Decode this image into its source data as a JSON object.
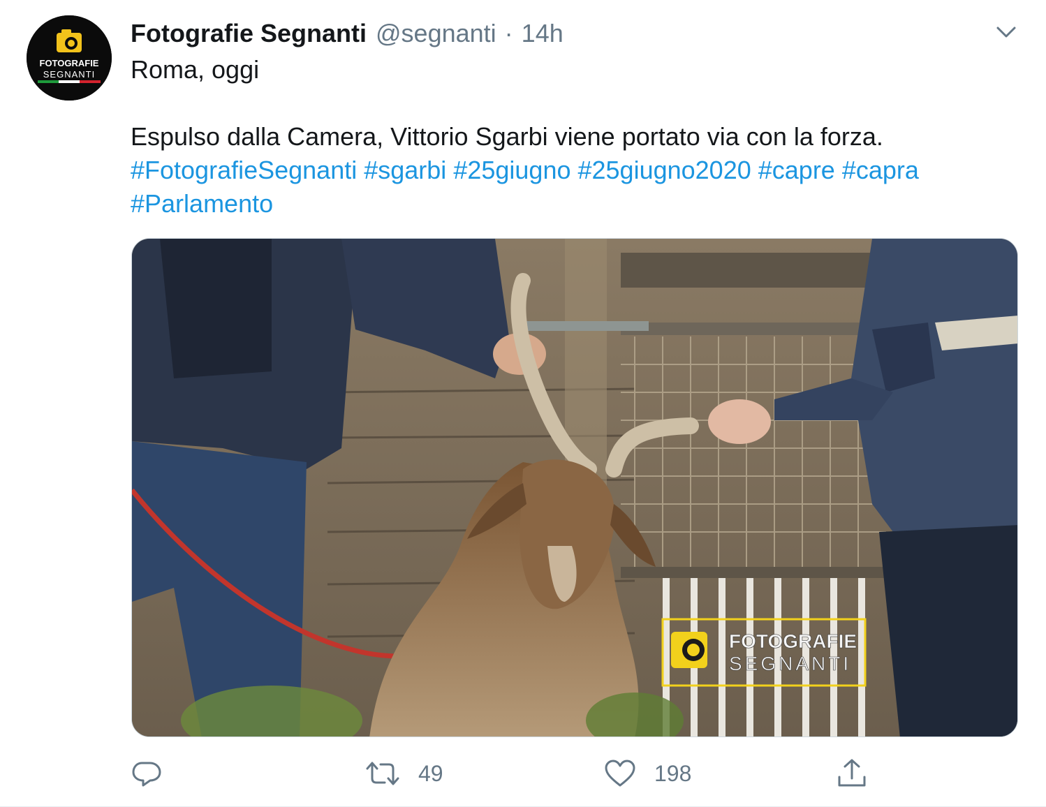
{
  "tweet": {
    "author": {
      "display_name": "Fotografie Segnanti",
      "handle": "@segnanti",
      "separator": "·",
      "time": "14h",
      "avatar_text_line1": "FOTOGRAFIE",
      "avatar_text_line2": "SEGNANTI"
    },
    "text": {
      "line1": "Roma, oggi",
      "line2": "Espulso dalla Camera, Vittorio Sgarbi viene portato via con la forza."
    },
    "hashtags": [
      "#FotografieSegnanti",
      "#sgarbi",
      "#25giugno",
      "#25giugno2020",
      "#capre",
      "#capra",
      "#Parlamento"
    ],
    "media": {
      "watermark_line1": "FOTOGRAFIE",
      "watermark_line2": "SEGNANTI"
    },
    "actions": {
      "reply": {
        "icon": "reply-icon",
        "count": ""
      },
      "retweet": {
        "icon": "retweet-icon",
        "count": "49"
      },
      "like": {
        "icon": "heart-icon",
        "count": "198"
      },
      "share": {
        "icon": "share-icon",
        "count": ""
      }
    }
  },
  "colors": {
    "text": "#14171a",
    "secondary": "#657786",
    "link": "#1b95e0",
    "border": "#e6ecf0",
    "watermark_yellow": "#f2d11c"
  }
}
